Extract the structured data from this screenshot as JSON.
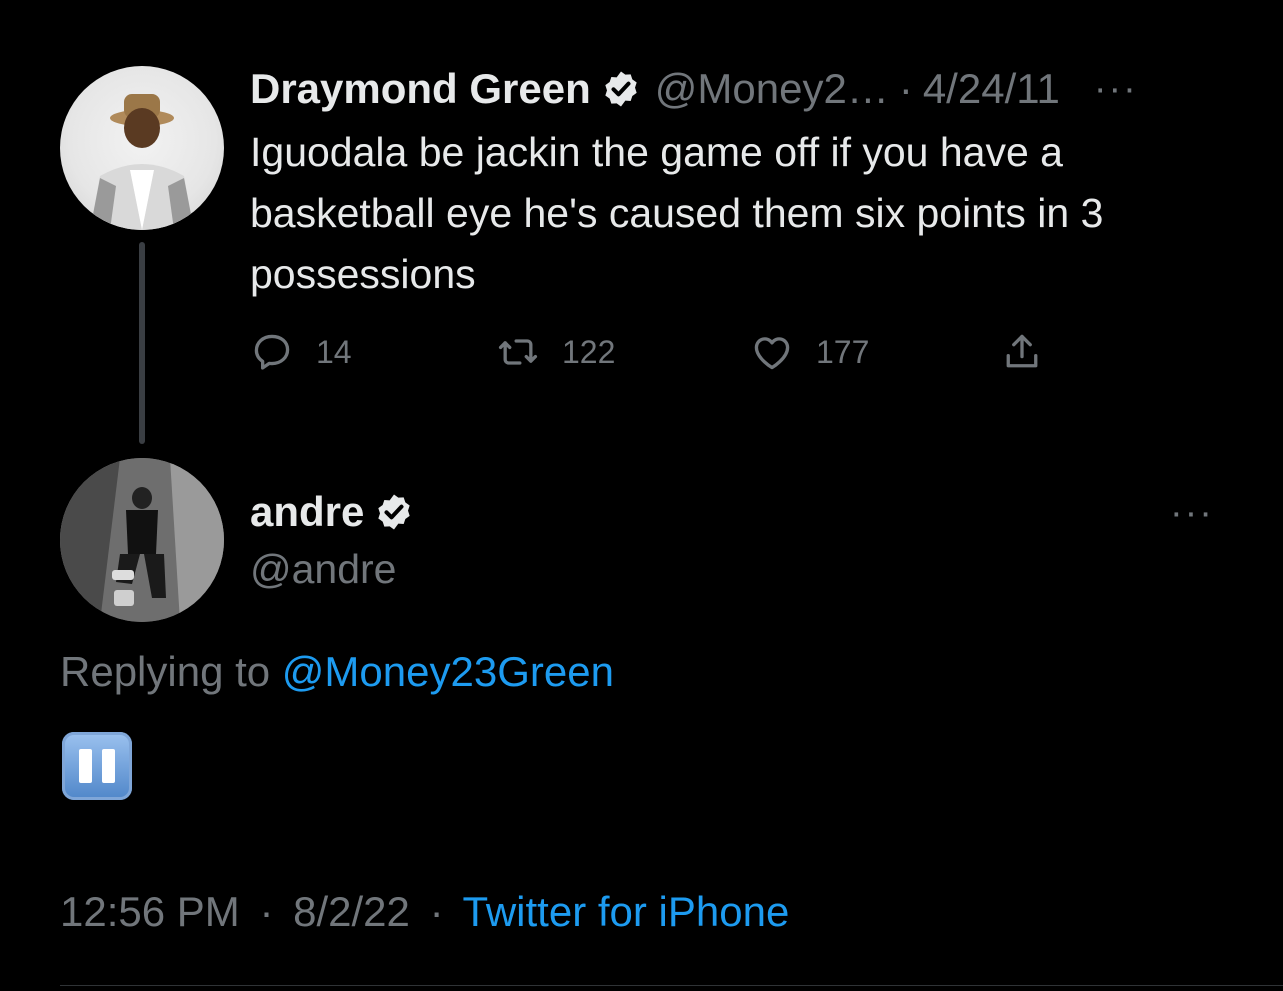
{
  "parent_tweet": {
    "author_name": "Draymond Green",
    "handle": "@Money2…",
    "separator": "·",
    "date": "4/24/11",
    "more": "···",
    "text": "Iguodala be jackin the game off if you have a basketball eye he's caused them six points in 3 possessions",
    "counts": {
      "replies": "14",
      "retweets": "122",
      "likes": "177"
    }
  },
  "reply_tweet": {
    "author_name": "andre",
    "handle": "@andre",
    "more": "···",
    "replying_prefix": "Replying to",
    "replying_handle": "@Money23Green",
    "emoji": "pause-button-emoji",
    "time": "12:56 PM",
    "separator": "·",
    "date": "8/2/22",
    "source": "Twitter for iPhone"
  },
  "colors": {
    "background": "#000000",
    "text": "#e7e9ea",
    "muted": "#71767b",
    "link": "#1d9bf0"
  }
}
